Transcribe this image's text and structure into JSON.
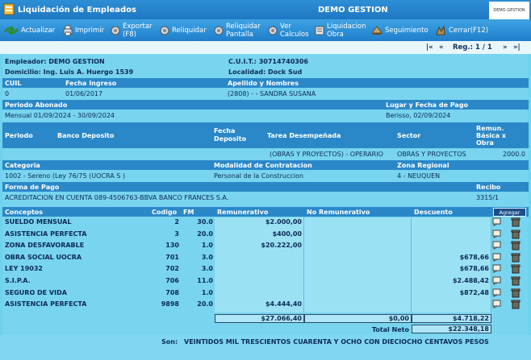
{
  "window": {
    "title": "Liquidación de Empleados",
    "company": "DEMO GESTION",
    "logo_text": "DEMO GESTION"
  },
  "toolbar": [
    {
      "label": "Actualizar",
      "icon": "refresh-icon"
    },
    {
      "label": "Imprimir",
      "icon": "printer-icon"
    },
    {
      "label": "Exportar\n(F8)",
      "icon": "export-icon"
    },
    {
      "label": "Reliquidar",
      "icon": "recalc-icon"
    },
    {
      "label": "Reliquidar\nPantalla",
      "icon": "recalc-screen-icon"
    },
    {
      "label": "Ver\nCalculos",
      "icon": "view-calc-icon"
    },
    {
      "label": "Liquidacion\nObra",
      "icon": "liq-obra-icon"
    },
    {
      "label": "Seguimiento",
      "icon": "tracking-icon"
    },
    {
      "label": "Cerrar(F12)",
      "icon": "close-icon"
    }
  ],
  "nav": {
    "first": "|«",
    "prev": "«",
    "reg": "Reg.: 1 / 1",
    "next": "»",
    "last": "»|"
  },
  "empleador": {
    "label": "Empleador: DEMO GESTION",
    "cuit": "C.U.I.T.: 30714740306",
    "domicilio": "Domicilio: Ing. Luis A. Huergo 1539",
    "localidad": "Localidad: Dock Sud"
  },
  "headers": {
    "cuil": "CUIL",
    "fecha_ingreso": "Fecha Ingreso",
    "apellido": "Apellido y Nombres",
    "periodo_abonado": "Periodo Abonado",
    "lugar_fecha": "Lugar y Fecha de Pago",
    "periodo": "Periodo",
    "banco": "Banco Deposito",
    "fecha_dep": "Fecha\nDeposito",
    "tarea": "Tarea Desempeñada",
    "sector": "Sector",
    "remun": "Remun.\nBásica x\nObra",
    "categoria": "Categoria",
    "modalidad": "Modalidad de Contratacion",
    "zona": "Zona Regional",
    "forma_pago": "Forma de Pago",
    "recibo": "Recibo"
  },
  "values": {
    "cuil": "0",
    "fecha_ingreso": "01/06/2017",
    "apellido": "(2808) - - SANDRA SUSANA",
    "periodo_abonado": "Mensual 01/09/2024 - 30/09/2024",
    "lugar_fecha": "Berisso, 02/09/2024",
    "tarea": "(OBRAS Y PROYECTOS) - OPERARIO",
    "sector": "OBRAS Y PROYECTOS",
    "remun": "2000.0",
    "categoria": "1002 - Sereno (Ley 76/75 (UOCRA S )",
    "modalidad": "Personal de la Construccion",
    "zona": "4 - NEUQUEN",
    "forma_pago": "ACREDITACION EN CUENTA 089-4506763-BBVA BANCO FRANCES S.A.",
    "recibo": "3315/1"
  },
  "table": {
    "columns": [
      "Conceptos",
      "Codigo",
      "FM",
      "Remunerativo",
      "No Remunerativo",
      "Descuento"
    ],
    "add_button": "Agregar",
    "rows": [
      {
        "concepto": "SUELDO MENSUAL",
        "codigo": "2",
        "fm": "30.0",
        "rem": "$2.000,00",
        "norem": "",
        "desc": ""
      },
      {
        "concepto": "ASISTENCIA PERFECTA",
        "codigo": "3",
        "fm": "20.0",
        "rem": "$400,00",
        "norem": "",
        "desc": ""
      },
      {
        "concepto": "ZONA DESFAVORABLE",
        "codigo": "130",
        "fm": "1.0",
        "rem": "$20.222,00",
        "norem": "",
        "desc": ""
      },
      {
        "concepto": "OBRA SOCIAL UOCRA",
        "codigo": "701",
        "fm": "3.0",
        "rem": "",
        "norem": "",
        "desc": "$678,66"
      },
      {
        "concepto": "LEY 19032",
        "codigo": "702",
        "fm": "3.0",
        "rem": "",
        "norem": "",
        "desc": "$678,66"
      },
      {
        "concepto": "S.I.P.A.",
        "codigo": "706",
        "fm": "11.0",
        "rem": "",
        "norem": "",
        "desc": "$2.488,42"
      },
      {
        "concepto": "SEGURO DE VIDA",
        "codigo": "708",
        "fm": "1.0",
        "rem": "",
        "norem": "",
        "desc": "$872,48"
      },
      {
        "concepto": "ASISTENCIA PERFECTA",
        "codigo": "9898",
        "fm": "20.0",
        "rem": "$4.444,40",
        "norem": "",
        "desc": ""
      }
    ],
    "totals": {
      "rem": "$27.066,40",
      "norem": "$0,00",
      "desc": "$4.718,22"
    },
    "total_neto_label": "Total Neto",
    "total_neto": "$22.348,18"
  },
  "footer": {
    "son_label": "Son:",
    "son_text": "VEINTIDOS MIL TRESCIENTOS CUARENTA Y OCHO CON DIECIOCHO CENTAVOS PESOS"
  }
}
